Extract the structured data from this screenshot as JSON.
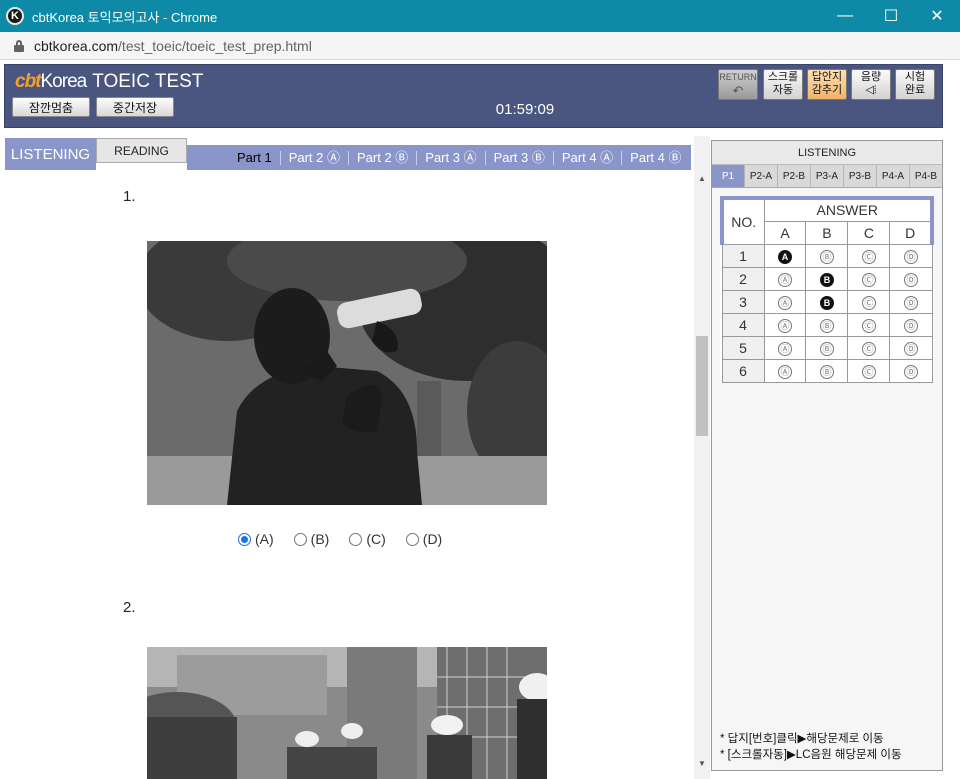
{
  "window": {
    "app_icon_letter": "K",
    "title": "cbtKorea 토익모의고사 - Chrome",
    "minimize": "—",
    "maximize": "☐",
    "close": "✕"
  },
  "address": {
    "host": "cbtkorea.com",
    "path": "/test_toeic/toeic_test_prep.html"
  },
  "header": {
    "logo_cbt": "cbt",
    "logo_korea": "Korea",
    "title": "TOEIC TEST",
    "pause_label": "잠깐멈춤",
    "save_label": "중간저장",
    "timer": "01:59:09",
    "return_top": "RETURN",
    "return_icon": "↶",
    "scroll_line1": "스크롤",
    "scroll_line2": "자동",
    "hide_line1": "답안지",
    "hide_line2": "감추기",
    "volume_line1": "음량",
    "volume_icon": "◁⦙",
    "finish_line1": "시험",
    "finish_line2": "완료"
  },
  "sections": {
    "listening": "LISTENING",
    "reading": "READING",
    "parts": [
      "Part 1",
      "Part 2 Ⓐ",
      "Part 2 Ⓑ",
      "Part 3 Ⓐ",
      "Part 3 Ⓑ",
      "Part 4 Ⓐ",
      "Part 4 Ⓑ"
    ],
    "active_part": "Part 1"
  },
  "questions": [
    {
      "number": "1.",
      "options": [
        "(A)",
        "(B)",
        "(C)",
        "(D)"
      ],
      "selected": "(A)"
    },
    {
      "number": "2."
    }
  ],
  "scrollbar": {
    "up": "▲",
    "down": "▼"
  },
  "answer_sheet": {
    "title": "LISTENING",
    "tabs": [
      "P1",
      "P2-A",
      "P2-B",
      "P3-A",
      "P3-B",
      "P4-A",
      "P4-B"
    ],
    "active_tab": "P1",
    "col_no": "NO.",
    "col_answer": "ANSWER",
    "choices": [
      "A",
      "B",
      "C",
      "D"
    ],
    "bubble_letters": [
      "Ⓐ",
      "Ⓑ",
      "Ⓒ",
      "Ⓓ"
    ],
    "rows": [
      {
        "no": "1",
        "marked": "A"
      },
      {
        "no": "2",
        "marked": "B"
      },
      {
        "no": "3",
        "marked": "B"
      },
      {
        "no": "4",
        "marked": ""
      },
      {
        "no": "5",
        "marked": ""
      },
      {
        "no": "6",
        "marked": ""
      }
    ],
    "note1": "* 답지[번호]클릭▶해당문제로 이동",
    "note2": "* [스크롤자동]▶LC음원 해당문제 이동"
  },
  "colors": {
    "titlebar": "#0f8aa6",
    "header_bg": "#4a5580",
    "section_blue": "#8a96c9",
    "radio_checked": "#1a73e8"
  }
}
